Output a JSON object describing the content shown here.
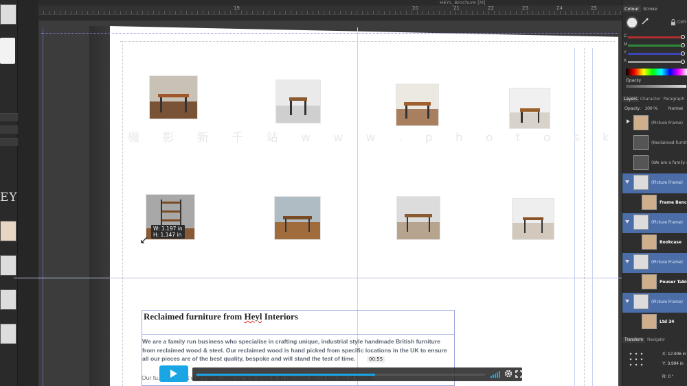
{
  "window": {
    "doc_title": "HEYL_Brochure [M]"
  },
  "ruler": {
    "ticks": [
      {
        "label": "19"
      },
      {
        "label": "20"
      },
      {
        "label": "21"
      },
      {
        "label": "22"
      },
      {
        "label": "23"
      },
      {
        "label": "24"
      },
      {
        "label": "25"
      }
    ]
  },
  "left_panel": {
    "logo_text": "EY"
  },
  "canvas": {
    "watermark": "機 影 新 千 站   w w w . p h o t o s k s . v i p",
    "size_tip": {
      "w": "W: 1.197 in",
      "h": "H: 1.147 in"
    },
    "headline_prefix": "Reclaimed furniture from ",
    "headline_brand": "Heyl",
    "headline_suffix": " Interiors",
    "body_paragraph_1": "We are a family run business who specialise in crafting unique, industrial style handmade British furniture from reclaimed wood & steel. Our reclaimed wood is hand picked from specific locations in the UK to ensure all our pieces are of the best quality, bespoke and will stand the test of time.",
    "body_paragraph_2": "Our fu... the UK. It was mainly used as floor joists in its previous life so has lots of history."
  },
  "player": {
    "time": "00:55",
    "progress": 0.62
  },
  "right_panel": {
    "tabs": [
      "Colour",
      "Stroke"
    ],
    "color_model": "CMY",
    "sliders": [
      {
        "label": "C",
        "color": "#b03030",
        "value": 0.97
      },
      {
        "label": "M",
        "color": "#2f8a3a",
        "value": 0.97
      },
      {
        "label": "Y",
        "color": "#3a46b5",
        "value": 0.97
      },
      {
        "label": "K",
        "color": "#9a9a9a",
        "value": 0.97
      }
    ],
    "opacity_label": "Opacity",
    "layers_tabs": [
      "Layers",
      "Character",
      "Paragraph"
    ],
    "layers_opacity_label": "Opacity:",
    "layers_opacity_value": "100 %",
    "blend_mode": "Normal",
    "layers": [
      {
        "text": "(Picture Frame)",
        "selected": false,
        "bold": false
      },
      {
        "text": "(Reclaimed furniture",
        "selected": false,
        "bold": false
      },
      {
        "text": "(We are a family run",
        "selected": false,
        "bold": false
      },
      {
        "text": "(Picture Frame)",
        "selected": true,
        "bold": false
      },
      {
        "text": "Frame Bench",
        "selected": false,
        "bold": true
      },
      {
        "text": "(Picture Frame)",
        "selected": true,
        "bold": false
      },
      {
        "text": "Bookcase",
        "selected": false,
        "bold": true
      },
      {
        "text": "(Picture Frame)",
        "selected": true,
        "bold": false
      },
      {
        "text": "Pouser Table",
        "selected": false,
        "bold": true
      },
      {
        "text": "(Picture Frame)",
        "selected": true,
        "bold": false
      },
      {
        "text": "Ltd 34",
        "selected": false,
        "bold": true
      }
    ],
    "transform_tabs": [
      "Transform",
      "Navigator"
    ],
    "transform": {
      "x_label": "X:",
      "x": "12.906 in",
      "y_label": "Y:",
      "y": "3.994 in",
      "r_label": "R:",
      "r": "0 °"
    }
  }
}
